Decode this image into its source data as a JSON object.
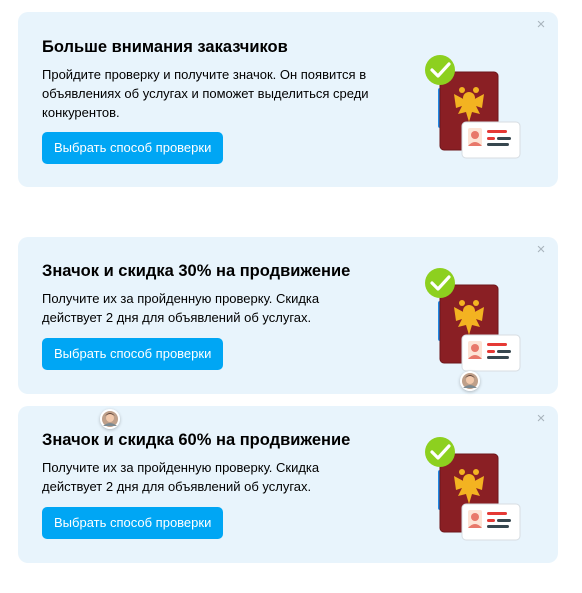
{
  "cards": [
    {
      "title": "Больше внимания заказчиков",
      "description": "Пройдите проверку и получите значок. Он появится в объявлениях об услугах и поможет выделиться среди конкурентов.",
      "button_label": "Выбрать способ проверки",
      "close_glyph": "×",
      "illustration_icon": "passport-verified-icon"
    },
    {
      "title": "Значок и скидка 30% на продвижение",
      "description": "Получите их за пройденную проверку. Скидка действует 2 дня для объявлений об услугах.",
      "button_label": "Выбрать способ проверки",
      "close_glyph": "×",
      "illustration_icon": "passport-verified-icon"
    },
    {
      "title": "Значок и скидка 60% на продвижение",
      "description": "Получите их за пройденную проверку. Скидка действует 2 дня для объявлений об услугах.",
      "button_label": "Выбрать способ проверки",
      "close_glyph": "×",
      "illustration_icon": "passport-verified-icon"
    }
  ],
  "colors": {
    "card_background": "#e8f4fc",
    "button": "#00a6f4",
    "check": "#8dd01f",
    "passport": "#8a1f24",
    "emblem": "#f3b321"
  }
}
